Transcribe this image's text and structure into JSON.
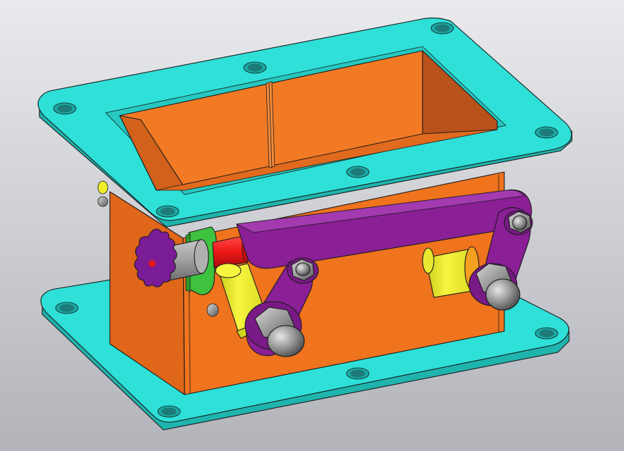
{
  "viewport": {
    "background_top": "#e9eaed",
    "background_bottom": "#b2b4ba",
    "projection": "isometric",
    "display_mode": "shaded-with-edges"
  },
  "model": {
    "parts": [
      {
        "name": "top-flange",
        "color": "#2ee0d8"
      },
      {
        "name": "bottom-flange",
        "color": "#2ee0d8"
      },
      {
        "name": "housing",
        "color": "#f0731e"
      },
      {
        "name": "housing-inner",
        "color": "#d2611c"
      },
      {
        "name": "lever-arm",
        "color": "#8a1f96"
      },
      {
        "name": "spring-cylinders",
        "color": "#eeee2a"
      },
      {
        "name": "shaft",
        "color": "#ee1818"
      },
      {
        "name": "side-plate",
        "color": "#3fc23f"
      },
      {
        "name": "star-knob",
        "color": "#6a1784"
      },
      {
        "name": "cap-nuts",
        "color": "#8c8c8c"
      }
    ]
  }
}
